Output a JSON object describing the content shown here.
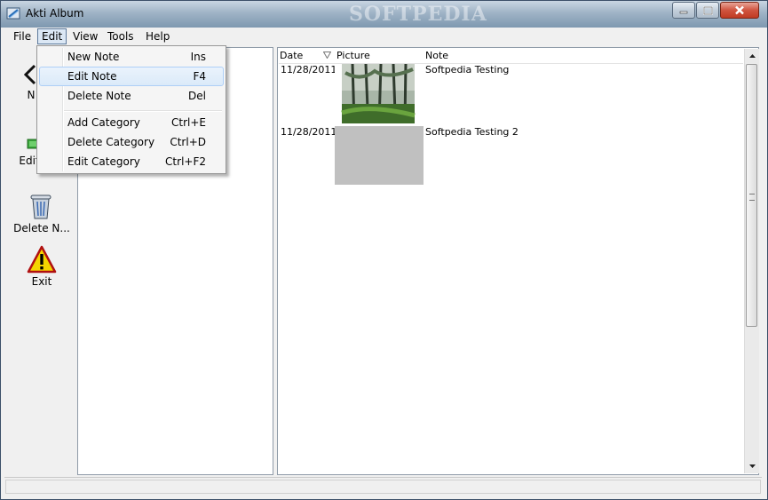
{
  "window": {
    "title": "Akti Album",
    "watermark": "SOFTPEDIA"
  },
  "menubar": {
    "items": [
      "File",
      "Edit",
      "View",
      "Tools",
      "Help"
    ],
    "active": "Edit"
  },
  "edit_menu": {
    "items": [
      {
        "label": "New Note",
        "shortcut": "Ins"
      },
      {
        "label": "Edit Note",
        "shortcut": "F4"
      },
      {
        "label": "Delete Note",
        "shortcut": "Del"
      },
      {
        "label": "Add Category",
        "shortcut": "Ctrl+E"
      },
      {
        "label": "Delete Category",
        "shortcut": "Ctrl+D"
      },
      {
        "label": "Edit Category",
        "shortcut": "Ctrl+F2"
      }
    ],
    "highlighted": "Edit Note"
  },
  "toolbar": {
    "buttons": [
      {
        "label": "N",
        "icon": "new-note-icon"
      },
      {
        "label": "Edit",
        "icon": "edit-note-icon"
      },
      {
        "label": "Delete N...",
        "icon": "trash-icon"
      },
      {
        "label": "Exit",
        "icon": "warning-icon"
      }
    ]
  },
  "notes_list": {
    "columns": [
      "Date",
      "Picture",
      "Note"
    ],
    "sort_column": "Date",
    "rows": [
      {
        "date": "11/28/2011",
        "picture": "forest-thumbnail",
        "note": "Softpedia Testing"
      },
      {
        "date": "11/28/2011",
        "picture": "empty-thumbnail",
        "note": "Softpedia Testing 2"
      }
    ]
  },
  "colors": {
    "title_bar": "#9fb3c6",
    "close_button": "#d0543f",
    "highlight": "#dbeaf9",
    "empty_thumb": "#c0c0c0"
  }
}
